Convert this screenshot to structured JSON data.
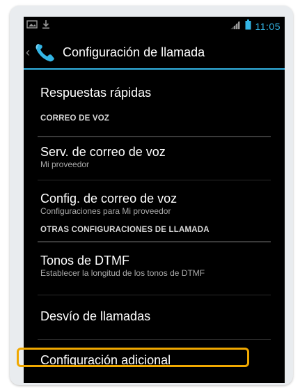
{
  "status_bar": {
    "time": "11:05",
    "icons": [
      "screenshot-icon",
      "download-icon",
      "signal-icon",
      "battery-icon"
    ]
  },
  "action_bar": {
    "title": "Configuración de llamada",
    "icon": "phone-icon",
    "accent_color": "#33b5e5"
  },
  "list": {
    "quick_responses": {
      "title": "Respuestas rápidas"
    },
    "section_voicemail": "CORREO DE VOZ",
    "voicemail_service": {
      "title": "Serv. de correo de voz",
      "subtitle": "Mi proveedor"
    },
    "voicemail_settings": {
      "title": "Config. de correo de voz",
      "subtitle": "Configuraciones para Mi proveedor"
    },
    "section_other": "OTRAS CONFIGURACIONES DE LLAMADA",
    "dtmf_tones": {
      "title": "Tonos de DTMF",
      "subtitle": "Establecer la longitud de los tonos de DTMF"
    },
    "call_forwarding": {
      "title": "Desvío de llamadas"
    },
    "additional_settings": {
      "title": "Configuración adicional"
    }
  },
  "highlight_color": "#f0a800"
}
